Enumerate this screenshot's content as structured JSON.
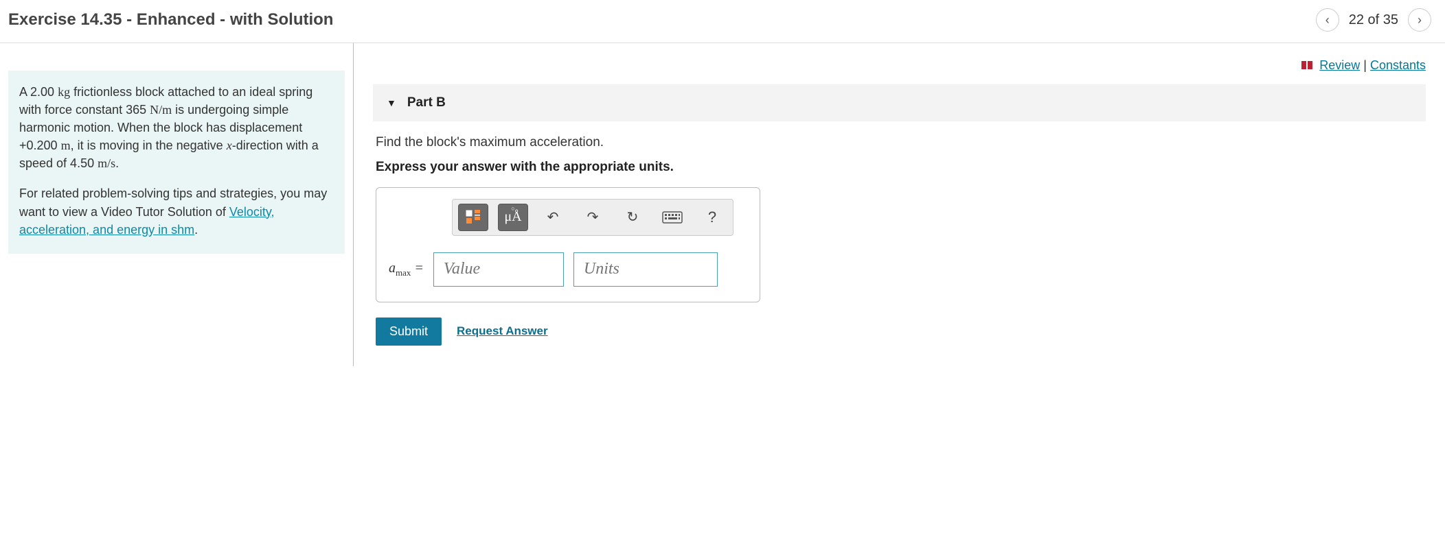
{
  "header": {
    "title": "Exercise 14.35 - Enhanced - with Solution",
    "pager": {
      "label": "22 of 35"
    }
  },
  "topLinks": {
    "review": "Review",
    "sep": " | ",
    "constants": "Constants"
  },
  "problem": {
    "line_a": "A 2.00 ",
    "unit_kg": "kg",
    "line_b": " frictionless block attached to an ideal spring with force constant 365 ",
    "unit_nm": "N/m",
    "line_c": " is undergoing simple harmonic motion. When the block has displacement +0.200 ",
    "unit_m": "m",
    "line_d": ", it is moving in the negative ",
    "var_x": "x",
    "line_e": "-direction with a speed of 4.50 ",
    "unit_ms": "m/s",
    "line_f": ".",
    "p2a": "For related problem-solving tips and strategies, you may want to view a Video Tutor Solution of ",
    "p2link": "Velocity, acceleration, and energy in shm",
    "p2b": "."
  },
  "part": {
    "label": "Part B",
    "prompt": "Find the block's maximum acceleration.",
    "instruction": "Express your answer with the appropriate units.",
    "variable_html": "a<sub>max</sub> =",
    "value_placeholder": "Value",
    "units_placeholder": "Units",
    "toolbar": {
      "units_symbol": "μÅ",
      "help": "?"
    },
    "submit": "Submit",
    "request": "Request Answer"
  }
}
